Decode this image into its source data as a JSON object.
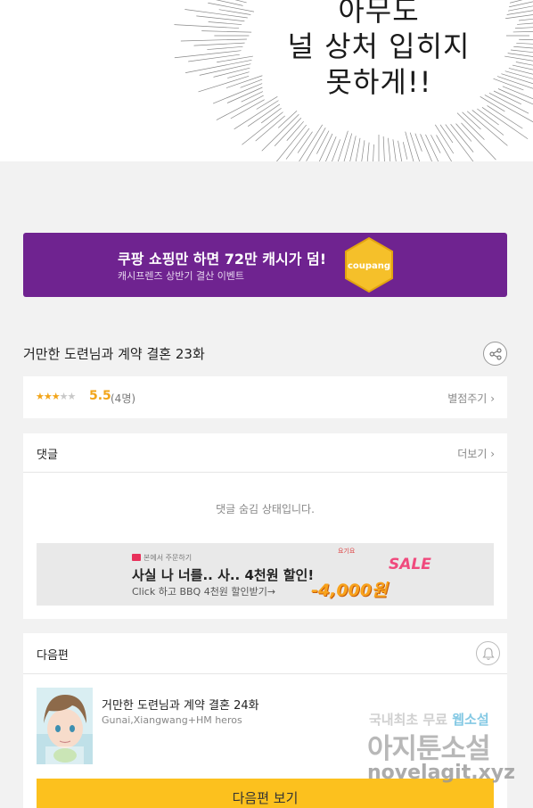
{
  "comic": {
    "line1": "아무도",
    "line2": "널 상처 입히지",
    "line3": "못하게!!"
  },
  "banner": {
    "headline": "쿠팡 쇼핑만 하면 72만 캐시가 덤!",
    "subline": "캐시프렌즈 상반기 결산 이벤트",
    "badge": "coupang",
    "colors": {
      "background": "#6f2390",
      "badge": "#f5c02a"
    }
  },
  "episode": {
    "title": "거만한 도련님과 계약 결혼 23화",
    "share_icon": "share-icon"
  },
  "rating": {
    "stars_filled": 3,
    "stars_total": 5,
    "score": "5.5",
    "voters": "(4명)",
    "rate_link": "별점주기"
  },
  "comments": {
    "heading": "댓글",
    "more_link": "더보기",
    "hidden_message": "댓글 숨김 상태입니다.",
    "ad": {
      "brand": "본에서 주문하기",
      "headline": "사실 나 너를.. 사.. 4천원 할인!",
      "subline": "Click 하고 BBQ 4천원 할인받기→",
      "tag": "요기요",
      "sale": "SALE",
      "price": "-4,000원"
    }
  },
  "next_episode": {
    "heading": "다음편",
    "title": "거만한 도련님과 계약 결혼 24화",
    "authors": "Gunai,Xiangwang+HM heros",
    "button": "다음편 보기",
    "bell_icon": "bell-icon",
    "button_color": "#fcc11e"
  },
  "watermark": {
    "line1_prefix": "국내최초 무료 ",
    "line1_highlight": "웹소설",
    "line2": "아지툰소설",
    "line3": "novelagit.xyz"
  }
}
